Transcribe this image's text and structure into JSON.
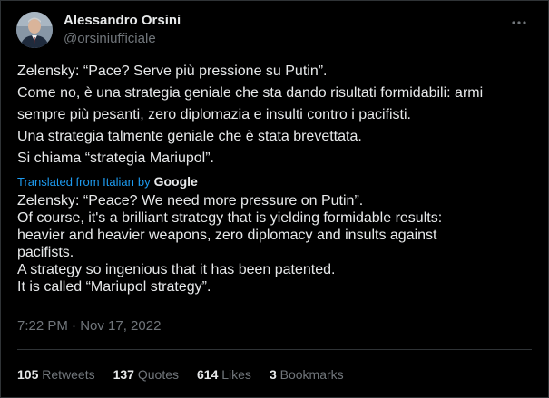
{
  "author": {
    "name": "Alessandro Orsini",
    "handle": "@orsiniufficiale"
  },
  "tweet": {
    "lines": [
      "Zelensky: “Pace? Serve più pressione su Putin”.",
      "Come no, è una strategia geniale che sta dando risultati formidabili: armi",
      "sempre più pesanti, zero diplomazia e insulti contro i pacifisti.",
      "Una strategia talmente geniale che è stata brevettata.",
      "Si chiama “strategia Mariupol”."
    ]
  },
  "translation": {
    "label": "Translated from Italian",
    "by": "by",
    "provider": "Google",
    "lines": [
      "Zelensky: “Peace? We need more pressure on Putin”.",
      "Of course, it's a brilliant strategy that is yielding formidable results:",
      "heavier and heavier weapons, zero diplomacy and insults against",
      "pacifists.",
      "A strategy so ingenious that it has been patented.",
      "It is called “Mariupol strategy”."
    ]
  },
  "timestamp": "7:22 PM · Nov 17, 2022",
  "stats": [
    {
      "count": "105",
      "label": "Retweets"
    },
    {
      "count": "137",
      "label": "Quotes"
    },
    {
      "count": "614",
      "label": "Likes"
    },
    {
      "count": "3",
      "label": "Bookmarks"
    }
  ],
  "colors": {
    "background": "#000000",
    "text": "#e7e9ea",
    "muted": "#71767b",
    "accent": "#1d9bf0",
    "border": "#2f3336"
  },
  "icons": {
    "more": "more-horizontal-icon",
    "avatar": "avatar-photo"
  }
}
